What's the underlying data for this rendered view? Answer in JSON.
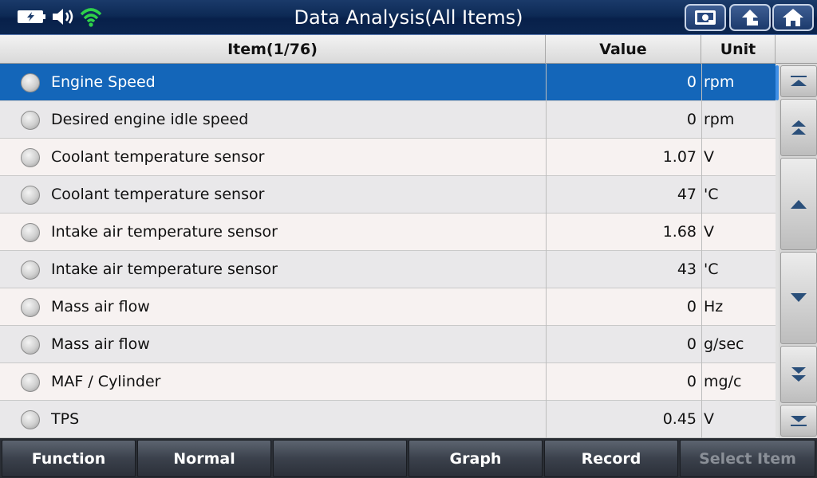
{
  "header": {
    "title": "Data Analysis(All Items)"
  },
  "table": {
    "col_item": "Item(1/76)",
    "col_value": "Value",
    "col_unit": "Unit",
    "rows": [
      {
        "name": "Engine Speed",
        "value": "0",
        "unit": "rpm"
      },
      {
        "name": "Desired engine idle speed",
        "value": "0",
        "unit": "rpm"
      },
      {
        "name": "Coolant temperature sensor",
        "value": "1.07",
        "unit": "V"
      },
      {
        "name": "Coolant temperature sensor",
        "value": "47",
        "unit": "'C"
      },
      {
        "name": "Intake air temperature sensor",
        "value": "1.68",
        "unit": "V"
      },
      {
        "name": "Intake air temperature sensor",
        "value": "43",
        "unit": "'C"
      },
      {
        "name": "Mass air flow",
        "value": "0",
        "unit": "Hz"
      },
      {
        "name": "Mass air flow",
        "value": "0",
        "unit": "g/sec"
      },
      {
        "name": "MAF / Cylinder",
        "value": "0",
        "unit": "mg/c"
      },
      {
        "name": "TPS",
        "value": "0.45",
        "unit": "V"
      }
    ]
  },
  "footer": {
    "function": "Function",
    "normal": "Normal",
    "empty": "",
    "graph": "Graph",
    "record": "Record",
    "select_item": "Select Item"
  },
  "colors": {
    "selected_row": "#1466b9",
    "title_bar": "#0d2a55",
    "wifi": "#2fd24a"
  },
  "icons": {
    "status": [
      "battery-charging-icon",
      "speaker-icon",
      "wifi-icon"
    ],
    "title_buttons": [
      "screenshot-icon",
      "back-icon",
      "home-icon"
    ],
    "scroll": [
      "scroll-top-icon",
      "page-up-icon",
      "line-up-icon",
      "line-down-icon",
      "page-down-icon",
      "scroll-bottom-icon"
    ]
  }
}
